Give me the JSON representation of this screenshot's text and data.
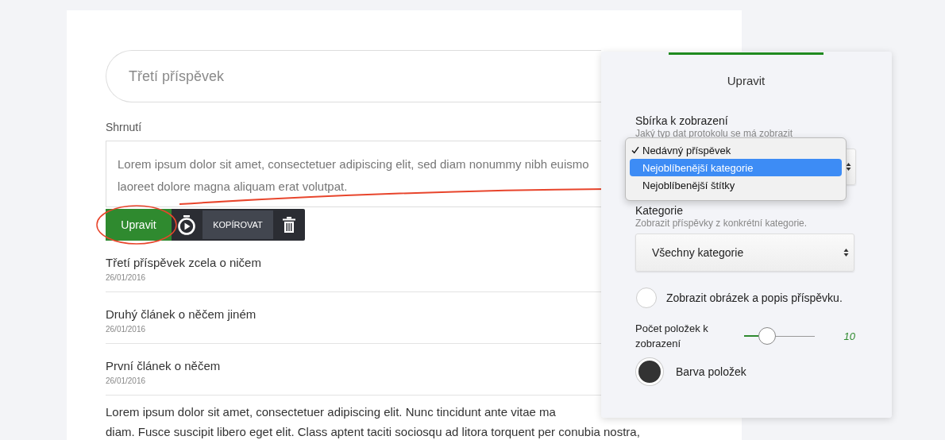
{
  "title_field": {
    "placeholder": "Třetí příspěvek"
  },
  "summary": {
    "label": "Shrnutí",
    "value_lines": [
      "Lorem ipsum dolor sit amet, consectetuer adipiscing elit, sed diam nonummy nibh euismo",
      "laoreet dolore magna aliquam erat volutpat."
    ]
  },
  "toolbar": {
    "edit_button": "Upravit",
    "copy_button": "KOPÍROVAT"
  },
  "posts": [
    {
      "title": "Třetí příspěvek zcela o ničem",
      "date": "26/01/2016"
    },
    {
      "title": "Druhý článek o něčem jiném",
      "date": "26/01/2016"
    },
    {
      "title": "První článek o něčem",
      "date": "26/01/2016"
    }
  ],
  "paragraph_lines": [
    "Lorem ipsum dolor sit amet, consectetuer adipiscing elit. Nunc tincidunt ante vitae ma",
    "diam. Fusce suscipit libero eget elit. Class aptent taciti sociosqu ad litora torquent per conubia nostra,"
  ],
  "panel": {
    "title": "Upravit",
    "collection": {
      "label": "Sbírka k zobrazení",
      "hint": "Jaký typ dat protokolu se má zobrazit",
      "options": [
        {
          "label": "Nedávný příspěvek",
          "checked": true,
          "selected": false
        },
        {
          "label": "Nejoblíbenější kategorie",
          "checked": false,
          "selected": true
        },
        {
          "label": "Nejoblíbenější štítky",
          "checked": false,
          "selected": false
        }
      ]
    },
    "category": {
      "label": "Kategorie",
      "hint": "Zobrazit příspěvky z konkrétní kategorie.",
      "value": "Všechny kategorie"
    },
    "show_image": {
      "label": "Zobrazit obrázek a popis příspěvku.",
      "checked": false
    },
    "item_count": {
      "label": "Počet položek k zobrazení",
      "level": 0.33,
      "reading": "10"
    },
    "item_color": {
      "label": "Barva položek",
      "color": "#333333"
    }
  }
}
